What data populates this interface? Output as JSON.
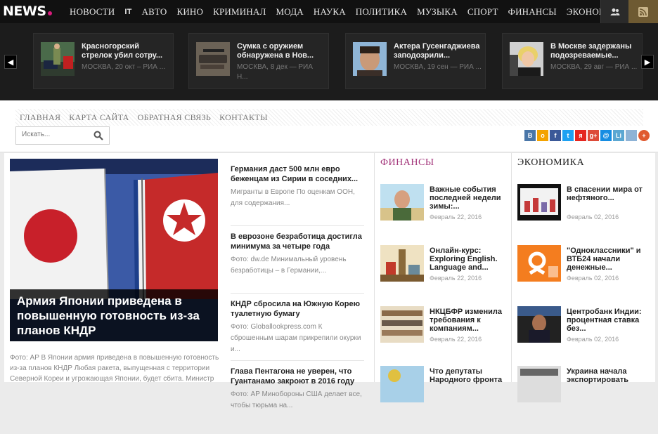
{
  "logo": {
    "text": "NEWS"
  },
  "nav": [
    "НОВОСТИ",
    "IT",
    "АВТО",
    "КИНО",
    "КРИМИНАЛ",
    "МОДА",
    "НАУКА",
    "ПОЛИТИКА",
    "МУЗЫКА",
    "СПОРТ",
    "ФИНАНСЫ",
    "ЭКОНОМИКА"
  ],
  "slider": [
    {
      "title": "Красногорский стрелок убил сотру...",
      "meta": "МОСКВА, 20 окт – РИА ..."
    },
    {
      "title": "Сумка с оружием обнаружена в Нов...",
      "meta": "МОСКВА, 8 дек — РИА Н..."
    },
    {
      "title": "Актера Гусенгаджиева заподозрили...",
      "meta": "МОСКВА, 19 сен — РИА ..."
    },
    {
      "title": "В Москве задержаны подозреваемые...",
      "meta": "МОСКВА, 29 авг — РИА ..."
    }
  ],
  "subnav": [
    "ГЛАВНАЯ",
    "КАРТА САЙТА",
    "ОБРАТНАЯ СВЯЗЬ",
    "КОНТАКТЫ"
  ],
  "search": {
    "placeholder": "Искать..."
  },
  "social": [
    {
      "icon": "vk-icon",
      "label": "В",
      "color": "#4a76a8"
    },
    {
      "icon": "ok-icon",
      "label": "o",
      "color": "#f4a300"
    },
    {
      "icon": "facebook-icon",
      "label": "f",
      "color": "#3b5998"
    },
    {
      "icon": "twitter-icon",
      "label": "t",
      "color": "#1da1f2"
    },
    {
      "icon": "yandex-icon",
      "label": "я",
      "color": "#e52620"
    },
    {
      "icon": "gplus-icon",
      "label": "g+",
      "color": "#dd4b39"
    },
    {
      "icon": "mail-icon",
      "label": "@",
      "color": "#168de2"
    },
    {
      "icon": "livejournal-icon",
      "label": "Li",
      "color": "#5ba7d2"
    },
    {
      "icon": "bookmark-icon",
      "label": "",
      "color": "#8eb3d6"
    },
    {
      "icon": "more-icon",
      "label": "+",
      "color": "#e05a30"
    }
  ],
  "featured": {
    "title": "Армия Японии приведена в повышенную готовность из-за планов КНДР",
    "text": "Фото: AP В Японии армия приведена в повышенную готовность из-за планов КНДР Любая ракета, выпущенная с территории Северной Кореи и угрожающая Японии, будет сбита. Министр"
  },
  "news_list": [
    {
      "title": "Германия даст 500 млн евро беженцам из Сирии в соседних...",
      "text": "Мигранты в Европе По оценкам ООН, для содержания..."
    },
    {
      "title": "В еврозоне безработица достигла минимума за четыре года",
      "text": "Фото: dw.de Минимальный уровень безработицы – в Германии,..."
    },
    {
      "title": "КНДР сбросила на Южную Корею туалетную бумагу",
      "text": "Фото: Globallookpress.com К сброшенным шарам прикрепили окурки и..."
    },
    {
      "title": "Глава Пентагона не уверен, что Гуантанамо закроют в 2016 году",
      "text": "Фото: AP Минобороны США делает все, чтобы тюрьма на..."
    }
  ],
  "finance": {
    "heading": "ФИНАНСЫ",
    "color": "#a3357a",
    "items": [
      {
        "title": "Важные события последней недели зимы:...",
        "date": "Февраль 22, 2016"
      },
      {
        "title": "Онлайн-курс: Exploring English. Language and...",
        "date": "Февраль 22, 2016"
      },
      {
        "title": "НКЦБФР изменила требования к компаниям...",
        "date": "Февраль 22, 2016"
      },
      {
        "title": "Что депутаты Народного фронта",
        "date": ""
      }
    ]
  },
  "economy": {
    "heading": "ЭКОНОМИКА",
    "color": "#222222",
    "items": [
      {
        "title": "В спасении мира от нефтяного...",
        "date": "Февраль 02, 2016"
      },
      {
        "title": "\"Одноклассники\" и ВТБ24 начали денежные...",
        "date": "Февраль 02, 2016"
      },
      {
        "title": "Центробанк Индии: процентная ставка без...",
        "date": "Февраль 02, 2016"
      },
      {
        "title": "Украина начала экспортировать",
        "date": ""
      }
    ]
  }
}
